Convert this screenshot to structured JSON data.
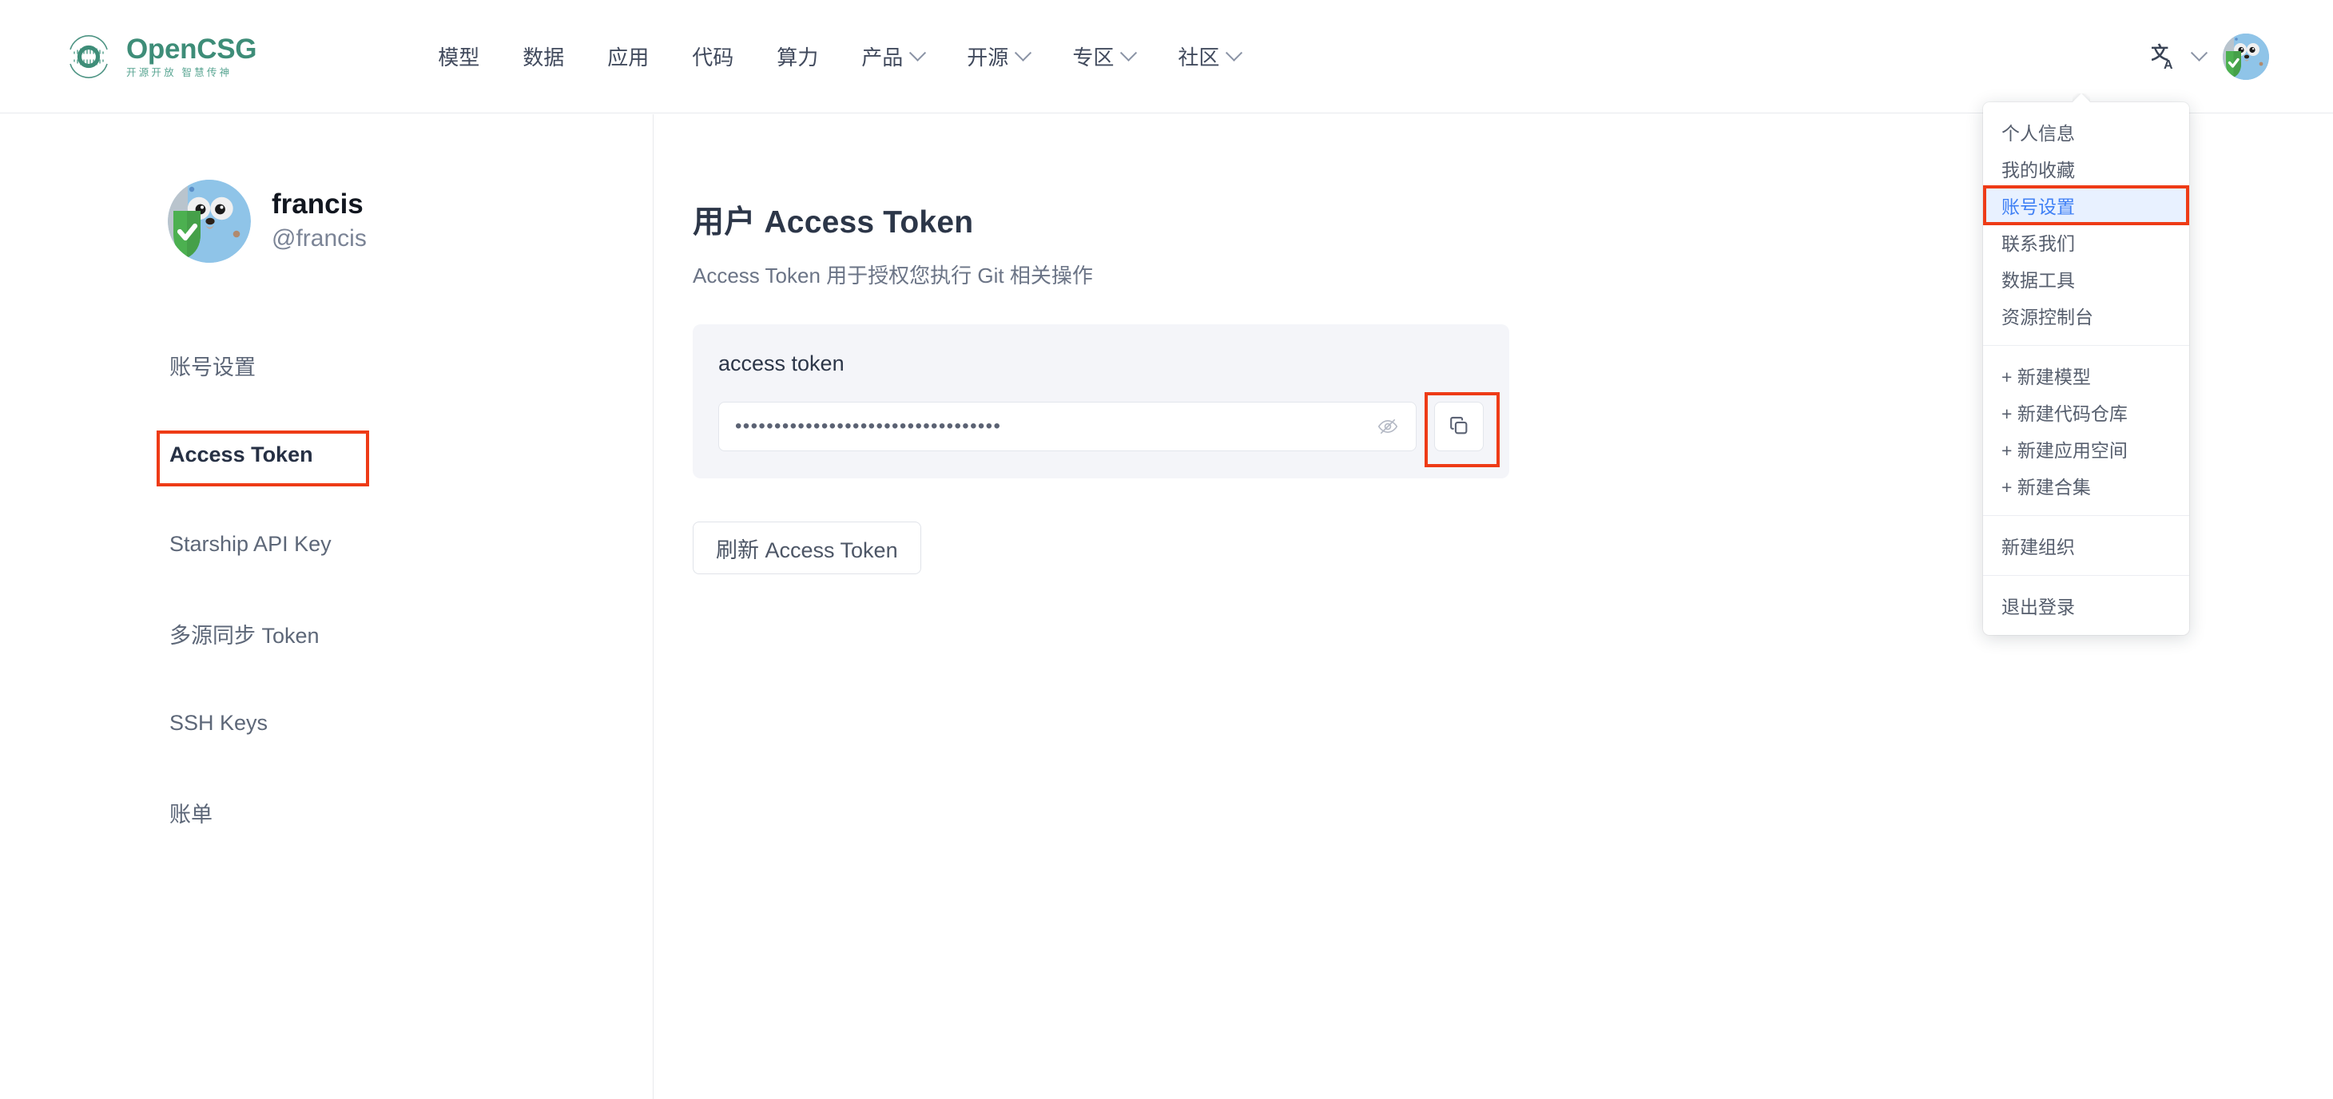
{
  "brand": {
    "name": "OpenCSG",
    "tagline": "开源开放 智慧传神",
    "color": "#3e8d78"
  },
  "header": {
    "nav": [
      {
        "label": "模型",
        "has_dropdown": false
      },
      {
        "label": "数据",
        "has_dropdown": false
      },
      {
        "label": "应用",
        "has_dropdown": false
      },
      {
        "label": "代码",
        "has_dropdown": false
      },
      {
        "label": "算力",
        "has_dropdown": false
      },
      {
        "label": "产品",
        "has_dropdown": true
      },
      {
        "label": "开源",
        "has_dropdown": true
      },
      {
        "label": "专区",
        "has_dropdown": true
      },
      {
        "label": "社区",
        "has_dropdown": true
      }
    ],
    "language_switcher": "translate-icon",
    "avatar": "gopher-shield-avatar"
  },
  "user_menu": {
    "sections": [
      {
        "items": [
          {
            "label": "个人信息",
            "selected": false,
            "annotated": false
          },
          {
            "label": "我的收藏",
            "selected": false,
            "annotated": false
          },
          {
            "label": "账号设置",
            "selected": true,
            "annotated": true
          },
          {
            "label": "联系我们",
            "selected": false,
            "annotated": false
          },
          {
            "label": "数据工具",
            "selected": false,
            "annotated": false
          },
          {
            "label": "资源控制台",
            "selected": false,
            "annotated": false
          }
        ]
      },
      {
        "items": [
          {
            "label": "+ 新建模型",
            "selected": false,
            "annotated": false
          },
          {
            "label": "+ 新建代码仓库",
            "selected": false,
            "annotated": false
          },
          {
            "label": "+ 新建应用空间",
            "selected": false,
            "annotated": false
          },
          {
            "label": "+ 新建合集",
            "selected": false,
            "annotated": false
          }
        ]
      },
      {
        "items": [
          {
            "label": "新建组织",
            "selected": false,
            "annotated": false
          }
        ]
      },
      {
        "items": [
          {
            "label": "退出登录",
            "selected": false,
            "annotated": false
          }
        ]
      }
    ]
  },
  "sidebar": {
    "profile": {
      "name": "francis",
      "handle": "@francis",
      "avatar": "gopher-shield-avatar"
    },
    "items": [
      {
        "label": "账号设置",
        "active": false,
        "annotated": false
      },
      {
        "label": "Access Token",
        "active": true,
        "annotated": true
      },
      {
        "label": "Starship API Key",
        "active": false,
        "annotated": false
      },
      {
        "label": "多源同步 Token",
        "active": false,
        "annotated": false
      },
      {
        "label": "SSH Keys",
        "active": false,
        "annotated": false
      },
      {
        "label": "账单",
        "active": false,
        "annotated": false
      }
    ]
  },
  "main": {
    "title": "用户 Access Token",
    "description": "Access Token 用于授权您执行 Git 相关操作",
    "card": {
      "label": "access token",
      "token_masked": "••••••••••••••••••••••••••••••••••",
      "reveal_icon": "eye-slash-icon",
      "copy_icon": "copy-icon"
    },
    "refresh_button": "刷新 Access Token"
  },
  "annotation": {
    "color": "#ee3b16"
  }
}
